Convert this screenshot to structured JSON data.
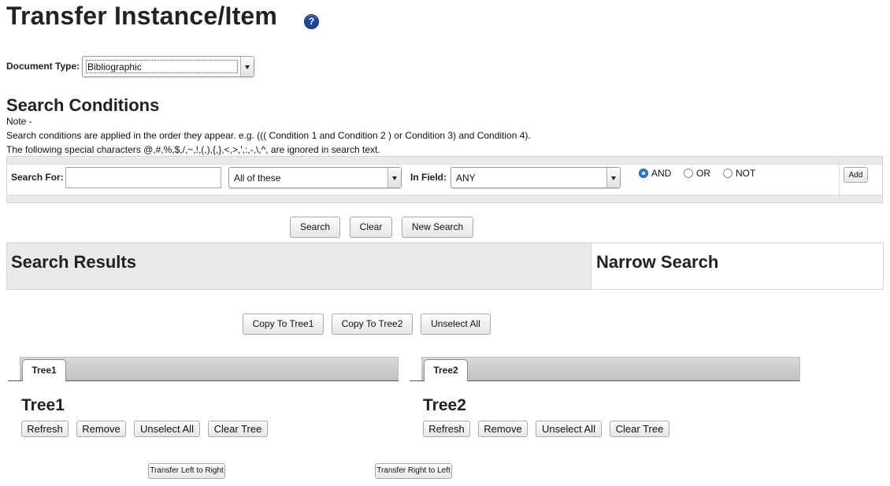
{
  "page": {
    "title": "Transfer Instance/Item",
    "help_icon": "?"
  },
  "document_type": {
    "label": "Document Type:",
    "selected": "Bibliographic"
  },
  "search_conditions": {
    "title": "Search Conditions",
    "note_label": "Note -",
    "note_order": "Search conditions are applied in the order they appear. e.g. ((( Condition 1 and Condition 2 ) or Condition 3) and Condition 4).",
    "note_special": "The following special characters @,#,%,$,/,~,!,(,),{,},<,>,',:,-,\\,^, are ignored in search text.",
    "search_for_label": "Search For:",
    "search_for_value": "",
    "match_selected": "All of these",
    "in_field_label": "In Field:",
    "in_field_selected": "ANY",
    "operators": {
      "and": "AND",
      "or": "OR",
      "not": "NOT",
      "selected": "AND"
    },
    "add_label": "Add"
  },
  "search_actions": {
    "search": "Search",
    "clear": "Clear",
    "new_search": "New Search"
  },
  "results": {
    "title": "Search Results",
    "narrow_title": "Narrow Search"
  },
  "copy_actions": {
    "copy_tree1": "Copy To Tree1",
    "copy_tree2": "Copy To Tree2",
    "unselect_all": "Unselect All"
  },
  "tree1": {
    "tab": "Tree1",
    "title": "Tree1",
    "refresh": "Refresh",
    "remove": "Remove",
    "unselect_all": "Unselect All",
    "clear_tree": "Clear Tree"
  },
  "tree2": {
    "tab": "Tree2",
    "title": "Tree2",
    "refresh": "Refresh",
    "remove": "Remove",
    "unselect_all": "Unselect All",
    "clear_tree": "Clear Tree"
  },
  "transfer": {
    "left_to_right": "Transfer Left to Right",
    "right_to_left": "Transfer Right to Left"
  },
  "colors": {
    "help_icon": "#1c4a9a",
    "radio_selected": "#2a7de1",
    "panel_band": "#e9e9e9"
  }
}
